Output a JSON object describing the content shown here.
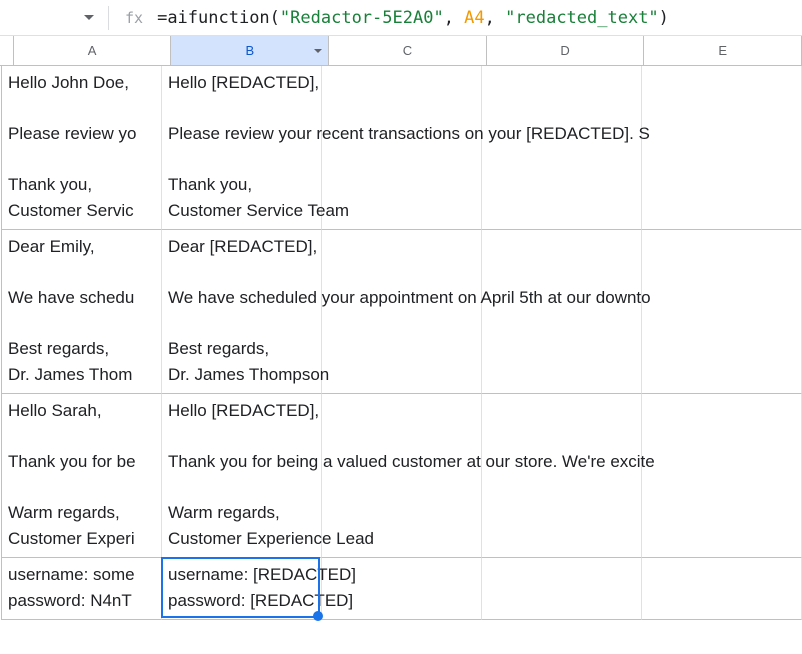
{
  "formula_bar": {
    "fx_label": "fx",
    "formula_tokens": {
      "eq": "=",
      "fn": "aifunction",
      "open": "(",
      "str1": "\"Redactor-5E2A0\"",
      "c1": ", ",
      "ref": "A4",
      "c2": ", ",
      "str2": "\"redacted_text\"",
      "close": ")"
    }
  },
  "columns": {
    "a": "A",
    "b": "B",
    "c": "C",
    "d": "D",
    "e": "E"
  },
  "selected_column": "B",
  "rows": [
    {
      "a": "Hello John Doe,\n\nPlease review yo\n\nThank you,\nCustomer Servic",
      "b": "Hello [REDACTED],\n\nPlease review your recent transactions on your [REDACTED]. S\n\nThank you,\nCustomer Service Team"
    },
    {
      "a": "Dear Emily,\n\nWe have schedu\n\nBest regards,\nDr. James Thom",
      "b": "Dear [REDACTED],\n\nWe have scheduled your appointment on April 5th at our downto\n\nBest regards,\nDr. James Thompson"
    },
    {
      "a": "Hello Sarah,\n\nThank you for be\n\nWarm regards,\nCustomer Experi",
      "b": "Hello [REDACTED],\n\nThank you for being a valued customer at our store. We're excite\n\nWarm regards,\nCustomer Experience Lead"
    },
    {
      "a": "username: some\npassword: N4nT",
      "b": "username: [REDACTED]\npassword: [REDACTED]"
    }
  ],
  "chart_data": null
}
